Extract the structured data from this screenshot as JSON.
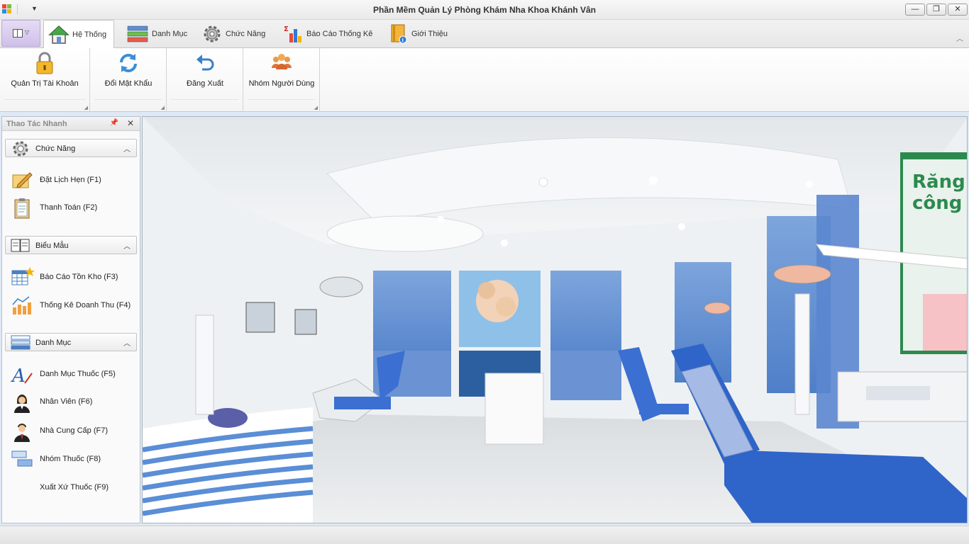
{
  "window": {
    "title": "Phần Mềm Quản Lý Phòng Khám Nha Khoa Khánh Vân",
    "minimize": "—",
    "restore": "❐",
    "close": "✕"
  },
  "tabs": [
    {
      "label": "Hệ Thống",
      "icon": "house-icon",
      "active": true
    },
    {
      "label": "Danh Mục",
      "icon": "list-icon"
    },
    {
      "label": "Chức Năng",
      "icon": "gear-icon"
    },
    {
      "label": "Báo Cáo Thống Kê",
      "icon": "bar-chart-icon"
    },
    {
      "label": "Giới Thiệu",
      "icon": "info-book-icon"
    }
  ],
  "ribbon": {
    "buttons": [
      {
        "label": "Quản Trị Tài Khoản",
        "icon": "lock-icon"
      },
      {
        "label": "Đổi Mật Khẩu",
        "icon": "refresh-icon"
      },
      {
        "label": "Đăng Xuất",
        "icon": "undo-arrow-icon"
      },
      {
        "label": "Nhóm Người Dùng",
        "icon": "user-group-icon"
      }
    ]
  },
  "panel": {
    "title": "Thao Tác Nhanh",
    "groups": [
      {
        "title": "Chức Năng",
        "items": [
          {
            "label": "Đặt Lịch Hẹn  (F1)",
            "icon": "pencil-icon"
          },
          {
            "label": "Thanh Toán (F2)",
            "icon": "clipboard-icon"
          }
        ]
      },
      {
        "title": "Biểu Mẫu",
        "items": [
          {
            "label": "Báo Cáo Tồn Kho (F3)",
            "icon": "spreadsheet-star-icon"
          },
          {
            "label": "Thống Kê Doanh Thu (F4)",
            "icon": "bar-chart-icon"
          }
        ]
      },
      {
        "title": "Danh Mục",
        "items": [
          {
            "label": "Danh Mục Thuốc (F5)",
            "icon": "font-a-icon"
          },
          {
            "label": "Nhân Viên (F6)",
            "icon": "woman-user-icon"
          },
          {
            "label": "Nhà Cung Cấp (F7)",
            "icon": "man-user-icon"
          },
          {
            "label": "Nhóm Thuốc (F8)",
            "icon": "group-boxes-icon"
          },
          {
            "label": "Xuất Xứ Thuốc (F9)",
            "icon": ""
          }
        ]
      }
    ]
  },
  "main_image": {
    "wall_text_1": "Răng s",
    "wall_text_2": "công n"
  },
  "colors": {
    "accent": "#3d6fb5",
    "chair_blue": "#2f64c9"
  }
}
